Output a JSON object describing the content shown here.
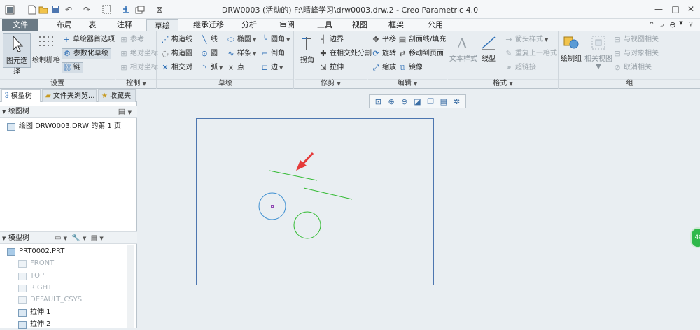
{
  "window": {
    "title": "DRW0003 (活动的) F:\\晴峰学习\\drw0003.drw.2 - Creo Parametric 4.0"
  },
  "tabs": [
    {
      "label": "文件"
    },
    {
      "label": "布局"
    },
    {
      "label": "表"
    },
    {
      "label": "注释"
    },
    {
      "label": "草绘"
    },
    {
      "label": "继承迁移"
    },
    {
      "label": "分析"
    },
    {
      "label": "审阅"
    },
    {
      "label": "工具"
    },
    {
      "label": "视图"
    },
    {
      "label": "框架"
    },
    {
      "label": "公用"
    }
  ],
  "ribbon": {
    "settings": {
      "label": "设置",
      "select": "图元选择",
      "grid": "绘制栅格",
      "prefs": "草绘器首选项",
      "param_sketch": "参数化草绘",
      "chain": "链"
    },
    "control": {
      "label": "控制",
      "reference": "参考",
      "abs_coord": "绝对坐标",
      "rel_coord": "相对坐标"
    },
    "sketch": {
      "label": "草绘",
      "construct_line": "构造线",
      "construct_circle": "构造圆",
      "intersect": "相交对",
      "line": "线",
      "circle": "圆",
      "arc": "弧",
      "ellipse": "椭圆",
      "spline": "样条",
      "point": "点",
      "fillet": "圆角",
      "chamfer": "倒角",
      "edge": "边"
    },
    "trim": {
      "label": "修剪",
      "corner": "拐角",
      "boundary": "边界",
      "split": "在相交处分割",
      "stretch": "拉伸"
    },
    "edit": {
      "label": "编辑",
      "translate": "平移",
      "section_fill": "剖面线/填充",
      "rotate": "旋转",
      "move_page": "移动到页面",
      "scale": "缩放",
      "mirror": "镜像"
    },
    "format": {
      "label": "格式",
      "text_style": "文本样式",
      "line_style": "线型",
      "arrow_style": "箭头样式",
      "repeat_format": "重复上一格式",
      "hyperlink": "超链接"
    },
    "group": {
      "label": "组",
      "draw_group": "绘制组",
      "relate_view": "相关视图",
      "relate_to_view": "与视图相关",
      "relate_to_object": "与对象相关",
      "cancel_relate": "取消相关"
    }
  },
  "panel": {
    "tabs": [
      {
        "label": "模型树"
      },
      {
        "label": "文件夹浏览..."
      },
      {
        "label": "收藏夹"
      }
    ],
    "drawing_tree": {
      "title": "绘图树",
      "item": "绘图 DRW0003.DRW 的第 1 页"
    },
    "model_tree": {
      "title": "模型树",
      "items": [
        {
          "label": "PRT0002.PRT"
        },
        {
          "label": "FRONT"
        },
        {
          "label": "TOP"
        },
        {
          "label": "RIGHT"
        },
        {
          "label": "DEFAULT_CSYS"
        },
        {
          "label": "拉伸 1"
        },
        {
          "label": "拉伸 2"
        }
      ]
    }
  },
  "badge": {
    "text": "48"
  },
  "colors": {
    "sketch_line": "#33bb33",
    "sketch_circle_blue": "#3d8fd1",
    "sketch_circle_green": "#33bb33",
    "sheet_border": "#4d76b0",
    "arrow": "#e53a3a"
  }
}
